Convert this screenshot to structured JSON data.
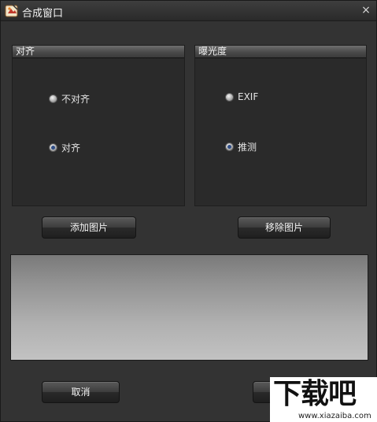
{
  "window": {
    "title": "合成窗口",
    "close_glyph": "×"
  },
  "align_group": {
    "header": "对齐",
    "options": [
      {
        "label": "不对齐",
        "checked": false
      },
      {
        "label": "对齐",
        "checked": true
      }
    ]
  },
  "exposure_group": {
    "header": "曝光度",
    "options": [
      {
        "label": "EXIF",
        "checked": false
      },
      {
        "label": "推测",
        "checked": true
      }
    ]
  },
  "buttons": {
    "add_image": "添加图片",
    "remove_image": "移除图片",
    "cancel": "取消"
  },
  "watermark": {
    "brand": "下载吧",
    "url": "www.xiazaiba.com"
  },
  "colors": {
    "radio_selected": "#2f4d86",
    "background": "#333333"
  }
}
